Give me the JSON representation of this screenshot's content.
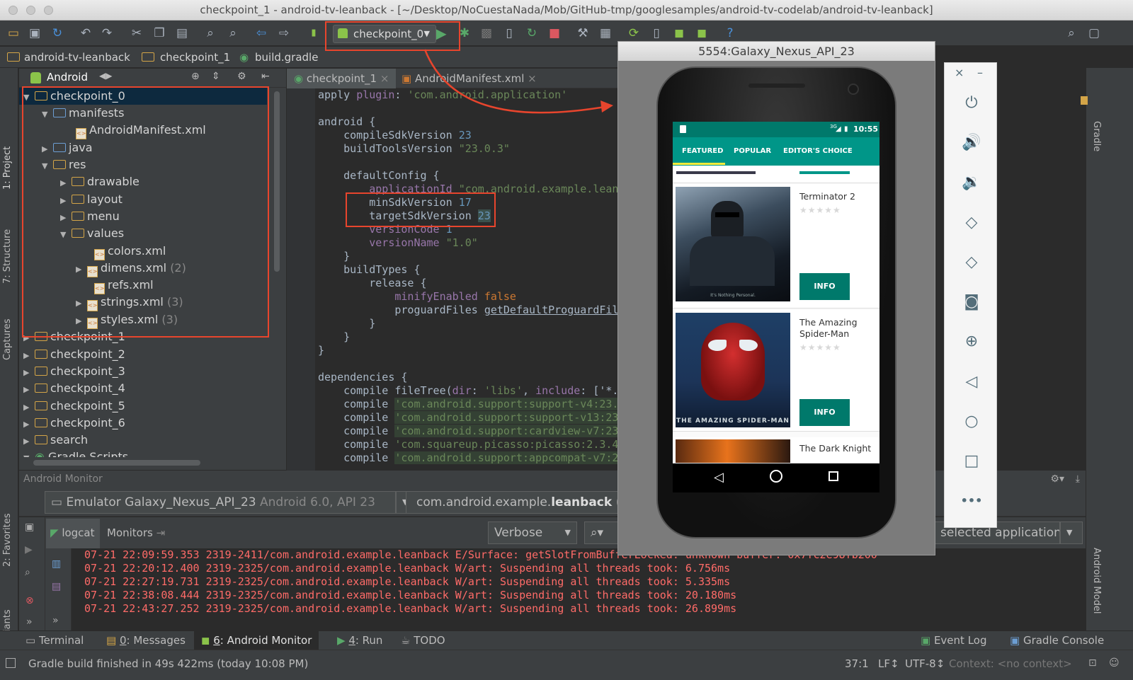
{
  "window": {
    "title": "checkpoint_1 - android-tv-leanback - [~/Desktop/NoCuestaNada/Mob/GitHub-tmp/googlesamples/android-tv-codelab/android-tv-leanback]"
  },
  "toolbar": {
    "run_config": "checkpoint_0"
  },
  "breadcrumb": {
    "items": [
      "android-tv-leanback",
      "checkpoint_1",
      "build.gradle"
    ]
  },
  "left_strip": {
    "project": "1: Project",
    "structure": "7: Structure",
    "captures": "Captures",
    "favorites": "2: Favorites",
    "build_variants": "Build Variants"
  },
  "right_strip": {
    "gradle": "Gradle",
    "android_model": "Android Model"
  },
  "project_panel": {
    "view_mode": "Android",
    "tree": [
      {
        "label": "checkpoint_0",
        "count": ""
      },
      {
        "label": "manifests",
        "count": ""
      },
      {
        "label": "AndroidManifest.xml",
        "count": ""
      },
      {
        "label": "java",
        "count": ""
      },
      {
        "label": "res",
        "count": ""
      },
      {
        "label": "drawable",
        "count": ""
      },
      {
        "label": "layout",
        "count": ""
      },
      {
        "label": "menu",
        "count": ""
      },
      {
        "label": "values",
        "count": ""
      },
      {
        "label": "colors.xml",
        "count": ""
      },
      {
        "label": "dimens.xml",
        "count": "(2)"
      },
      {
        "label": "refs.xml",
        "count": ""
      },
      {
        "label": "strings.xml",
        "count": "(3)"
      },
      {
        "label": "styles.xml",
        "count": "(3)"
      },
      {
        "label": "checkpoint_1",
        "count": ""
      },
      {
        "label": "checkpoint_2",
        "count": ""
      },
      {
        "label": "checkpoint_3",
        "count": ""
      },
      {
        "label": "checkpoint_4",
        "count": ""
      },
      {
        "label": "checkpoint_5",
        "count": ""
      },
      {
        "label": "checkpoint_6",
        "count": ""
      },
      {
        "label": "search",
        "count": ""
      },
      {
        "label": "Gradle Scripts",
        "count": ""
      }
    ]
  },
  "editor": {
    "tabs": [
      "checkpoint_1",
      "AndroidManifest.xml"
    ],
    "lines": {
      "l0a": "apply ",
      "l0b": "plugin",
      "l0c": ": ",
      "l0d": "'com.android.application'",
      "l1": "android {",
      "l2a": "    compileSdkVersion ",
      "l2b": "23",
      "l3a": "    buildToolsVersion ",
      "l3b": "\"23.0.3\"",
      "l5": "    defaultConfig {",
      "l6a": "        applicationId ",
      "l6b": "\"com.android.example.lean",
      "l7a": "        minSdkVersion ",
      "l7b": "17",
      "l8a": "        targetSdkVersion ",
      "l8b": "23",
      "l9a": "        versionCode ",
      "l9b": "1",
      "l10a": "        versionName ",
      "l10b": "\"1.0\"",
      "l11": "    }",
      "l12": "    buildTypes {",
      "l13": "        release {",
      "l14a": "            minifyEnabled ",
      "l14b": "false",
      "l15a": "            proguardFiles ",
      "l15b": "getDefaultProguardFil",
      "l16": "        }",
      "l17": "    }",
      "l18": "}",
      "l20": "dependencies {",
      "l21a": "    compile ",
      "l21b": "fileTree(",
      "l21c": "dir",
      "l21d": ": ",
      "l21e": "'libs'",
      "l21f": ", ",
      "l21g": "include",
      "l21h": ": ['*.",
      "l22a": "    compile ",
      "l22b": "'com.android.support:support-v4:23.",
      "l23a": "    compile ",
      "l23b": "'com.android.support:support-v13:23",
      "l24a": "    compile ",
      "l24b": "'com.android.support:cardview-v7:23",
      "l25a": "    compile ",
      "l25b": "'com.squareup.picasso:picasso:2.3.4",
      "l26a": "    compile ",
      "l26b": "'com.android.support:appcompat-v7:2"
    }
  },
  "monitor": {
    "title": "Android Monitor",
    "device_name": "Emulator Galaxy_Nexus_API_23",
    "device_meta": "Android 6.0, API 23",
    "process_a": "com.android.example.",
    "process_b": "leanback",
    "process_c": " (23",
    "tabs": [
      "logcat",
      "Monitors"
    ],
    "log_level": "Verbose",
    "filter": "selected application",
    "log_lines": [
      "07-21 22:09:59.353 2319-2411/com.android.example.leanback E/Surface: getSlotFromBufferLocked: unknown buffer: 0x7fc2e98fb200",
      "07-21 22:20:12.400 2319-2325/com.android.example.leanback W/art: Suspending all threads took: 6.756ms",
      "07-21 22:27:19.731 2319-2325/com.android.example.leanback W/art: Suspending all threads took: 5.335ms",
      "07-21 22:38:08.444 2319-2325/com.android.example.leanback W/art: Suspending all threads took: 20.180ms",
      "07-21 22:43:27.252 2319-2325/com.android.example.leanback W/art: Suspending all threads took: 26.899ms"
    ]
  },
  "bottom_tabs": {
    "terminal": "Terminal",
    "messages_num": "0",
    "messages": ": Messages",
    "monitor_num": "6",
    "monitor": ": Android Monitor",
    "run_num": "4",
    "run": ": Run",
    "todo": "TODO",
    "event_log": "Event Log",
    "gradle_console": "Gradle Console"
  },
  "status": {
    "message": "Gradle build finished in 49s 422ms (today 10:08 PM)",
    "position": "37:1",
    "line_sep": "LF↕",
    "encoding": "UTF-8↕",
    "context": "Context: <no context>"
  },
  "emulator": {
    "title": "5554:Galaxy_Nexus_API_23",
    "time": "10:55",
    "network": "3G",
    "tabs": [
      "FEATURED",
      "POPULAR",
      "EDITOR'S CHOICE"
    ],
    "movies": [
      {
        "title": "Terminator 2",
        "button": "INFO",
        "poster_caption": "It's Nothing Personal."
      },
      {
        "title": "The Amazing Spider-Man",
        "button": "INFO",
        "poster_caption": "THE AMAZING SPIDER-MAN"
      },
      {
        "title": "The Dark Knight",
        "button": "",
        "poster_caption": ""
      }
    ],
    "stars": "★★★★★",
    "more": "•••"
  },
  "colors": {
    "accent_red": "#e8452d",
    "teal": "#009688",
    "dark_teal": "#00796b"
  }
}
